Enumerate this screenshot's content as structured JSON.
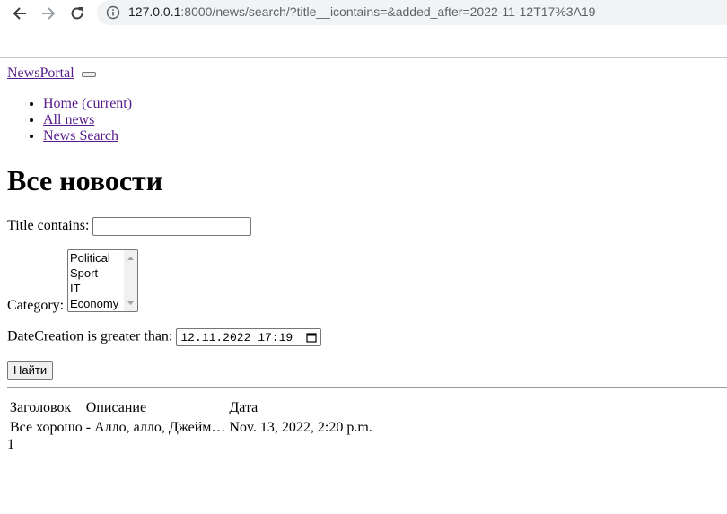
{
  "browser": {
    "url_host": "127.0.0.1",
    "url_rest": ":8000/news/search/?title__icontains=&added_after=2022-11-12T17%3A19"
  },
  "navbar": {
    "brand": "NewsPortal",
    "items": [
      {
        "label": "Home (current)"
      },
      {
        "label": "All news"
      },
      {
        "label": "News Search"
      }
    ]
  },
  "page": {
    "heading": "Все новости"
  },
  "filter": {
    "title_label": "Title contains:",
    "title_value": "",
    "category_label": "Category:",
    "category_options": [
      "Political",
      "Sport",
      "IT",
      "Economy"
    ],
    "date_label": "DateCreation is greater than:",
    "date_value": "12.11.2022 17:19",
    "submit_label": "Найти"
  },
  "table": {
    "headers": [
      "Заголовок",
      "Описание",
      "Дата"
    ],
    "rows": [
      [
        "Все хорошо",
        "- Алло, алло, Джейм…",
        "Nov. 13, 2022, 2:20 p.m."
      ]
    ]
  },
  "pagination": {
    "current": "1"
  }
}
